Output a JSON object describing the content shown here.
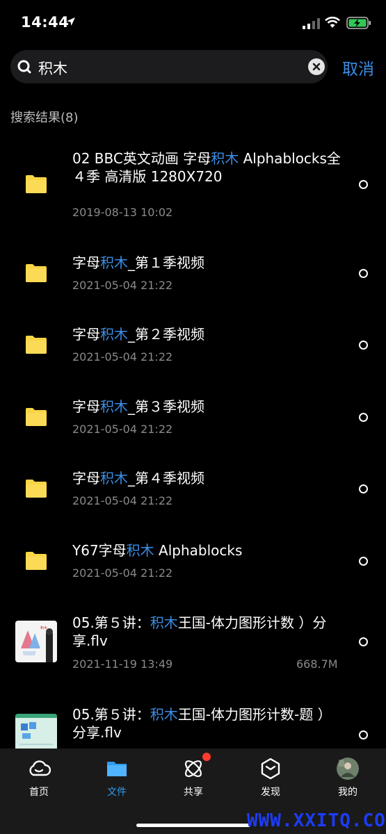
{
  "status": {
    "time": "14:44"
  },
  "search": {
    "query": "积木",
    "cancel_label": "取消"
  },
  "results_label": "搜索结果(8)",
  "items": [
    {
      "title_parts": [
        "02 BBC英文动画 字母",
        "积木",
        " Alphablocks全４季  高清版 1280X720"
      ],
      "date": "2019-08-13 10:02",
      "size": "",
      "kind": "folder"
    },
    {
      "title_parts": [
        "字母",
        "积木",
        "_第１季视频"
      ],
      "date": "2021-05-04 21:22",
      "size": "",
      "kind": "folder"
    },
    {
      "title_parts": [
        "字母",
        "积木",
        "_第２季视频"
      ],
      "date": "2021-05-04 21:22",
      "size": "",
      "kind": "folder"
    },
    {
      "title_parts": [
        "字母",
        "积木",
        "_第３季视频"
      ],
      "date": "2021-05-04 21:22",
      "size": "",
      "kind": "folder"
    },
    {
      "title_parts": [
        "字母",
        "积木",
        "_第４季视频"
      ],
      "date": "2021-05-04 21:22",
      "size": "",
      "kind": "folder"
    },
    {
      "title_parts": [
        "Y67字母",
        "积木",
        " Alphablocks"
      ],
      "date": "2021-05-04 21:22",
      "size": "",
      "kind": "folder"
    },
    {
      "title_parts": [
        "05.第５讲：",
        "积木",
        "王国-体力图形计数 ）分享.flv"
      ],
      "date": "2021-11-19 13:49",
      "size": "668.7M",
      "kind": "video"
    },
    {
      "title_parts": [
        "05.第５讲：",
        "积木",
        "王国-体力图形计数-题 ）分享.flv"
      ],
      "date": "",
      "size": "",
      "kind": "video"
    }
  ],
  "tabs": [
    {
      "label": "首页",
      "icon": "cloud-icon"
    },
    {
      "label": "文件",
      "icon": "folder-icon",
      "active": true
    },
    {
      "label": "共享",
      "icon": "atom-icon",
      "badge": true
    },
    {
      "label": "发现",
      "icon": "cube-icon"
    },
    {
      "label": "我的",
      "icon": "avatar"
    }
  ],
  "watermark": "WWW.XXITQ.COM",
  "colors": {
    "accent": "#3c8ee6",
    "folder": "#f9d545",
    "badge": "#ff3b30"
  }
}
